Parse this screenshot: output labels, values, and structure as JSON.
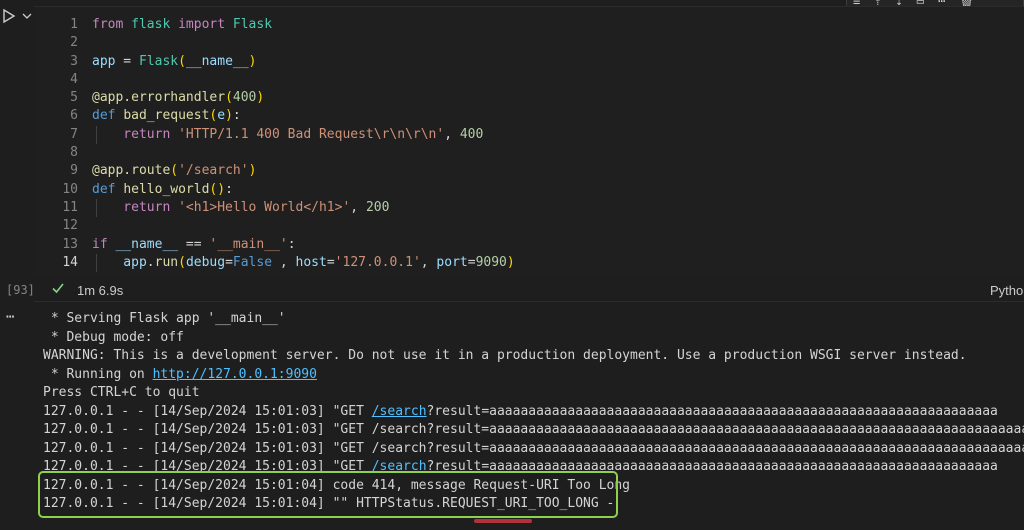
{
  "cell": {
    "exec_count": "[93]",
    "exec_time": "1m 6.9s",
    "language": "Pytho",
    "line_numbers": [
      "1",
      "2",
      "3",
      "4",
      "5",
      "6",
      "7",
      "8",
      "9",
      "10",
      "11",
      "12",
      "13",
      "14"
    ]
  },
  "code_lines": [
    [
      {
        "t": "from ",
        "c": "kw2"
      },
      {
        "t": "flask ",
        "c": "cls"
      },
      {
        "t": "import ",
        "c": "kw2"
      },
      {
        "t": "Flask",
        "c": "cls"
      }
    ],
    [],
    [
      {
        "t": "app",
        "c": "var"
      },
      {
        "t": " = "
      },
      {
        "t": "Flask",
        "c": "cls"
      },
      {
        "t": "(",
        "c": "br1"
      },
      {
        "t": "__name__",
        "c": "var"
      },
      {
        "t": ")",
        "c": "br1"
      }
    ],
    [],
    [
      {
        "t": "@app.errorhandler",
        "c": "dec"
      },
      {
        "t": "(",
        "c": "br1"
      },
      {
        "t": "400",
        "c": "num"
      },
      {
        "t": ")",
        "c": "br1"
      }
    ],
    [
      {
        "t": "def ",
        "c": "kw"
      },
      {
        "t": "bad_request",
        "c": "fn"
      },
      {
        "t": "(",
        "c": "br1"
      },
      {
        "t": "e",
        "c": "var"
      },
      {
        "t": ")",
        "c": "br1"
      },
      {
        "t": ":"
      }
    ],
    [
      {
        "t": "    return ",
        "c": "kw2"
      },
      {
        "t": "'HTTP/1.1 400 Bad Request\\r\\n\\r\\n'",
        "c": "str"
      },
      {
        "t": ", "
      },
      {
        "t": "400",
        "c": "num"
      }
    ],
    [],
    [
      {
        "t": "@app.route",
        "c": "dec"
      },
      {
        "t": "(",
        "c": "br1"
      },
      {
        "t": "'/search'",
        "c": "str"
      },
      {
        "t": ")",
        "c": "br1"
      }
    ],
    [
      {
        "t": "def ",
        "c": "kw"
      },
      {
        "t": "hello_world",
        "c": "fn"
      },
      {
        "t": "(",
        "c": "br1"
      },
      {
        "t": ")",
        "c": "br1"
      },
      {
        "t": ":"
      }
    ],
    [
      {
        "t": "    return ",
        "c": "kw2"
      },
      {
        "t": "'<h1>Hello World</h1>'",
        "c": "str"
      },
      {
        "t": ", "
      },
      {
        "t": "200",
        "c": "num"
      }
    ],
    [],
    [
      {
        "t": "if ",
        "c": "kw2"
      },
      {
        "t": "__name__",
        "c": "var"
      },
      {
        "t": " == "
      },
      {
        "t": "'__main__'",
        "c": "str"
      },
      {
        "t": ":"
      }
    ],
    [
      {
        "t": "    app",
        "c": "var"
      },
      {
        "t": "."
      },
      {
        "t": "run",
        "c": "fn"
      },
      {
        "t": "(",
        "c": "br1"
      },
      {
        "t": "debug",
        "c": "var"
      },
      {
        "t": "="
      },
      {
        "t": "False",
        "c": "kw"
      },
      {
        "t": " , "
      },
      {
        "t": "host",
        "c": "var"
      },
      {
        "t": "="
      },
      {
        "t": "'127.0.0.1'",
        "c": "str"
      },
      {
        "t": ", "
      },
      {
        "t": "port",
        "c": "var"
      },
      {
        "t": "="
      },
      {
        "t": "9090",
        "c": "num"
      },
      {
        "t": ")",
        "c": "br1"
      }
    ]
  ],
  "output_lines": [
    [
      {
        "t": " * Serving Flask app '__main__'"
      }
    ],
    [
      {
        "t": " * Debug mode: off"
      }
    ],
    [
      {
        "t": "WARNING: This is a development server. Do not use it in a production deployment. Use a production WSGI server instead."
      }
    ],
    [
      {
        "t": " * Running on "
      },
      {
        "t": "http://127.0.0.1:9090",
        "link": true
      }
    ],
    [
      {
        "t": "Press CTRL+C to quit"
      }
    ],
    [
      {
        "t": "127.0.0.1 - - [14/Sep/2024 15:01:03] \"GET "
      },
      {
        "t": "/search",
        "link": true
      },
      {
        "t": "?result=aaaaaaaaaaaaaaaaaaaaaaaaaaaaaaaaaaaaaaaaaaaaaaaaaaaaaaaaaaaaaaaaa"
      }
    ],
    [
      {
        "t": "127.0.0.1 - - [14/Sep/2024 15:01:03] \"GET /search?result=aaaaaaaaaaaaaaaaaaaaaaaaaaaaaaaaaaaaaaaaaaaaaaaaaaaaaaaaaaaaaaaaaaaaa"
      }
    ],
    [
      {
        "t": "127.0.0.1 - - [14/Sep/2024 15:01:03] \"GET /search?result=aaaaaaaaaaaaaaaaaaaaaaaaaaaaaaaaaaaaaaaaaaaaaaaaaaaaaaaaaaaaaaaaaaaaa"
      }
    ],
    [
      {
        "t": "127.0.0.1 - - [14/Sep/2024 15:01:03] \"GET "
      },
      {
        "t": "/search",
        "link": true
      },
      {
        "t": "?result=aaaaaaaaaaaaaaaaaaaaaaaaaaaaaaaaaaaaaaaaaaaaaaaaaaaaaaaaaaaaaaaaa"
      }
    ],
    [
      {
        "t": "127.0.0.1 - - [14/Sep/2024 15:01:04] code 414, message Request-URI Too Long"
      }
    ],
    [
      {
        "t": "127.0.0.1 - - [14/Sep/2024 15:01:04] \"\" HTTPStatus.REQUEST_URI_TOO_LONG -"
      }
    ]
  ],
  "colors": {
    "background": "#1e1e1e",
    "highlight_border": "#8fd14f",
    "link": "#4fc1ff",
    "success_check": "#89d185"
  }
}
